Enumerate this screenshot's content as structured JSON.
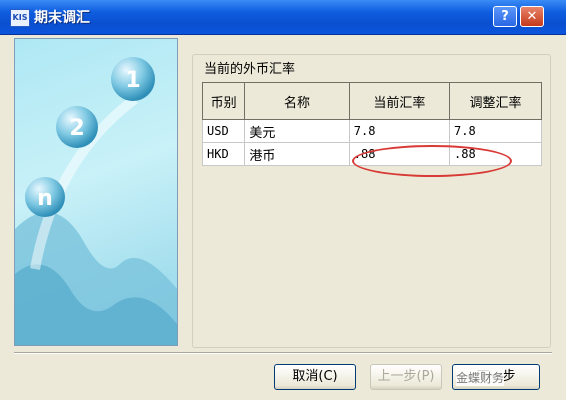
{
  "window": {
    "title": "期末调汇",
    "app_icon_text": "KIS",
    "help_glyph": "?",
    "close_glyph": "✕"
  },
  "banner": {
    "icon": "step-balls-illustration",
    "step_labels": [
      "1",
      "2",
      "n"
    ]
  },
  "group": {
    "label": "当前的外币汇率"
  },
  "table": {
    "headers": [
      "币别",
      "名称",
      "当前汇率",
      "调整汇率"
    ],
    "rows": [
      {
        "code": "USD",
        "name": "美元",
        "current": "7.8",
        "adjusted": "7.8"
      },
      {
        "code": "HKD",
        "name": "港币",
        "current": ".88",
        "adjusted": ".88"
      }
    ]
  },
  "buttons": {
    "cancel": "取消(C)",
    "prev": "上一步(P)",
    "next": "下一步"
  },
  "watermark": "金蝶财务",
  "colors": {
    "titlebar": "#0a4fd0",
    "highlight": "#d83a36",
    "dialog": "#ece9d8"
  }
}
